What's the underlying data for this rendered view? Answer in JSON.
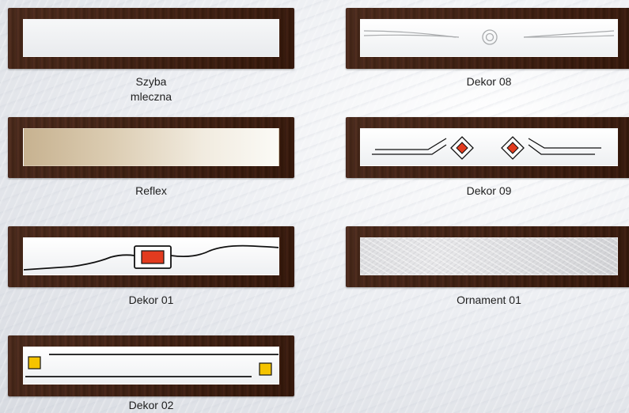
{
  "items": [
    {
      "label": "Szyba\nmleczna",
      "label_line1": "Szyba",
      "label_line2": "mleczna",
      "glass": "milky",
      "decor": "none"
    },
    {
      "label": "Dekor 08",
      "glass": "clear",
      "decor": "curved lines with concentric circles"
    },
    {
      "label": "Reflex",
      "glass": "reflex",
      "decor": "none"
    },
    {
      "label": "Dekor 09",
      "glass": "clear",
      "decor": "lines with two red diamonds"
    },
    {
      "label": "Dekor 01",
      "glass": "clear",
      "decor": "wavy line with red rectangle"
    },
    {
      "label": "Ornament 01",
      "glass": "ornament",
      "decor": "textured pattern"
    },
    {
      "label": "Dekor 02",
      "glass": "clear",
      "decor": "lines with two yellow squares"
    }
  ],
  "colors": {
    "frame_wood": "#3f1d10",
    "red_accent": "#e23b1f",
    "yellow_accent": "#f5c400",
    "line_dark": "#111111",
    "line_light": "#a9abad"
  }
}
